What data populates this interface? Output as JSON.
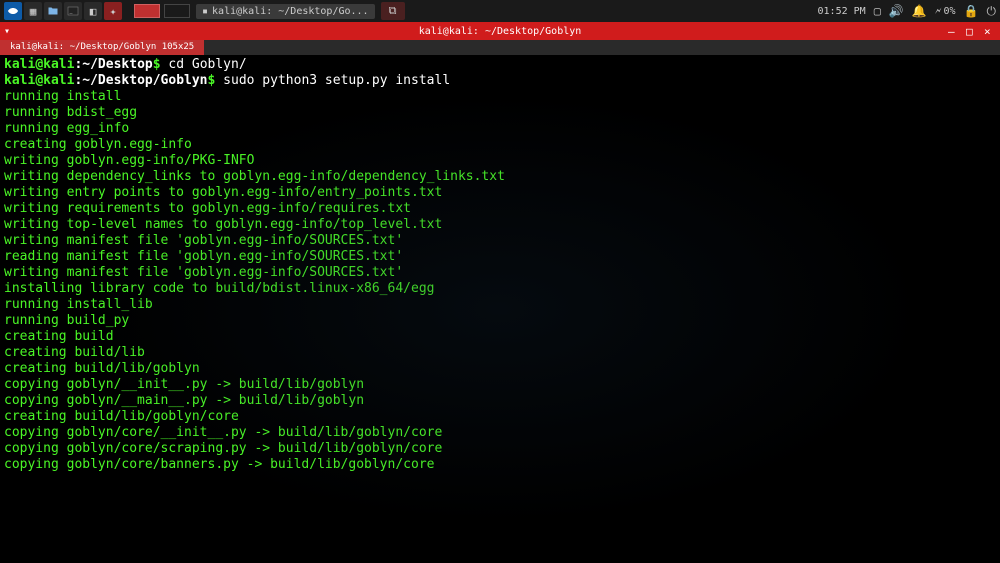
{
  "taskbar": {
    "apps": [
      {
        "label": "kali@kali: ~/Desktop/Go..."
      }
    ],
    "time": "01:52 PM",
    "battery": "0%"
  },
  "window": {
    "title": "kali@kali: ~/Desktop/Goblyn",
    "tab": "kali@kali: ~/Desktop/Goblyn 105x25"
  },
  "prompts": [
    {
      "user": "kali",
      "host": "kali",
      "path": "~/Desktop",
      "cmd": "cd Goblyn/"
    },
    {
      "user": "kali",
      "host": "kali",
      "path": "~/Desktop/Goblyn",
      "cmd": "sudo python3 setup.py install"
    }
  ],
  "output": [
    "running install",
    "running bdist_egg",
    "running egg_info",
    "creating goblyn.egg-info",
    "writing goblyn.egg-info/PKG-INFO",
    "writing dependency_links to goblyn.egg-info/dependency_links.txt",
    "writing entry points to goblyn.egg-info/entry_points.txt",
    "writing requirements to goblyn.egg-info/requires.txt",
    "writing top-level names to goblyn.egg-info/top_level.txt",
    "writing manifest file 'goblyn.egg-info/SOURCES.txt'",
    "reading manifest file 'goblyn.egg-info/SOURCES.txt'",
    "writing manifest file 'goblyn.egg-info/SOURCES.txt'",
    "installing library code to build/bdist.linux-x86_64/egg",
    "running install_lib",
    "running build_py",
    "creating build",
    "creating build/lib",
    "creating build/lib/goblyn",
    "copying goblyn/__init__.py -> build/lib/goblyn",
    "copying goblyn/__main__.py -> build/lib/goblyn",
    "creating build/lib/goblyn/core",
    "copying goblyn/core/__init__.py -> build/lib/goblyn/core",
    "copying goblyn/core/scraping.py -> build/lib/goblyn/core",
    "copying goblyn/core/banners.py -> build/lib/goblyn/core"
  ],
  "glyphs": {
    "at": "@",
    "colon": ":",
    "dollar": "$ "
  }
}
